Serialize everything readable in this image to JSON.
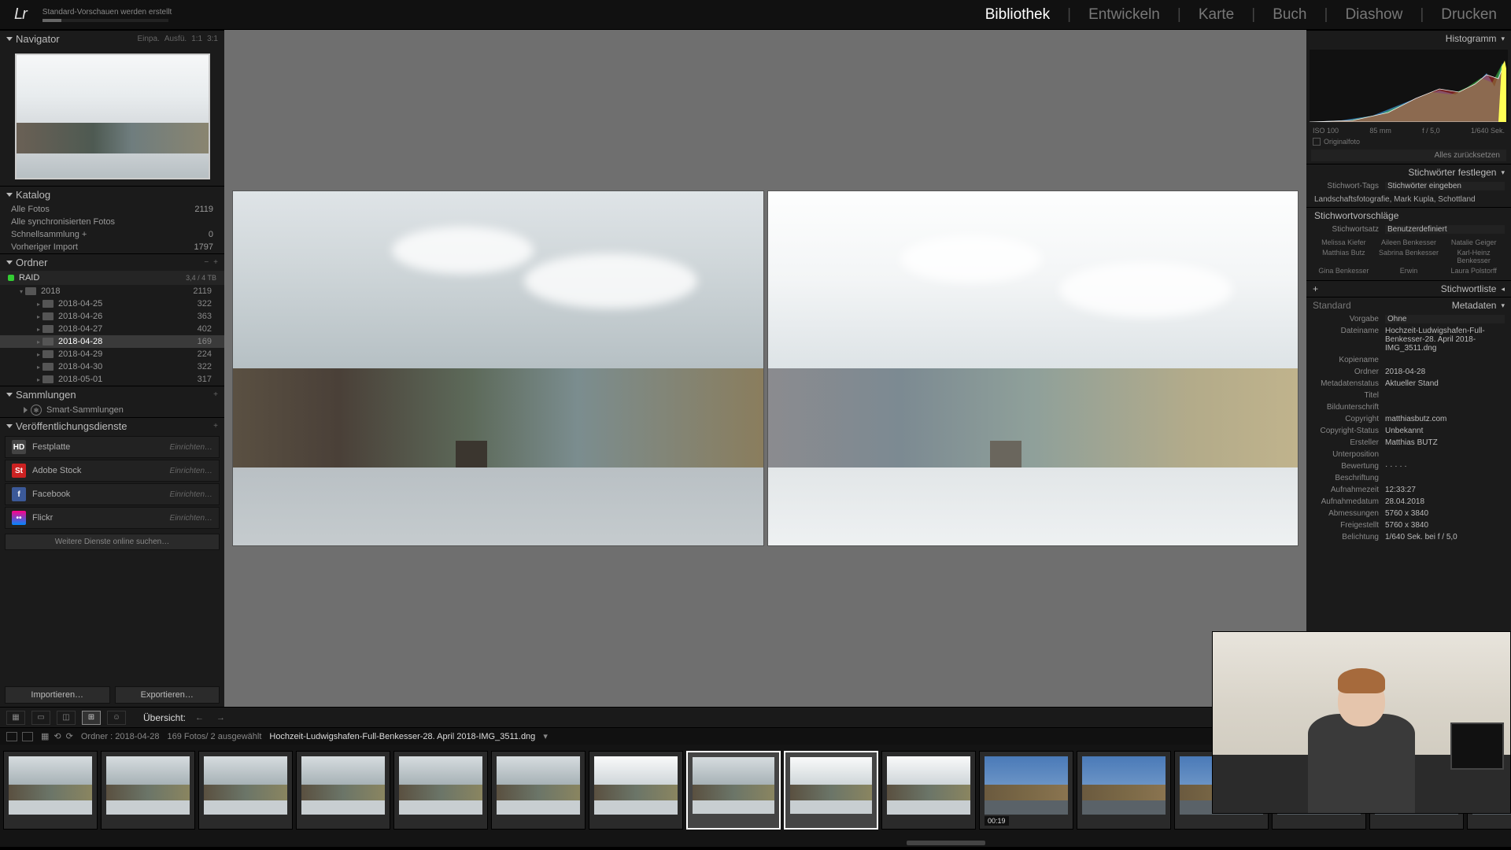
{
  "app": {
    "logo": "Lr",
    "task": "Standard-Vorschauen werden erstellt"
  },
  "modules": {
    "library": "Bibliothek",
    "develop": "Entwickeln",
    "map": "Karte",
    "book": "Buch",
    "slideshow": "Diashow",
    "print": "Drucken",
    "active": "library"
  },
  "left": {
    "navigator": {
      "title": "Navigator",
      "modes": [
        "Einpa.",
        "Ausfü.",
        "1:1",
        "3:1"
      ]
    },
    "catalog": {
      "title": "Katalog",
      "rows": [
        {
          "label": "Alle Fotos",
          "count": "2119"
        },
        {
          "label": "Alle synchronisierten Fotos",
          "count": ""
        },
        {
          "label": "Schnellsammlung  +",
          "count": "0"
        },
        {
          "label": "Vorheriger Import",
          "count": "1797"
        }
      ]
    },
    "folders": {
      "title": "Ordner",
      "volume": {
        "name": "RAID",
        "stat": "3,4 / 4 TB"
      },
      "year": {
        "label": "2018",
        "count": "2119"
      },
      "days": [
        {
          "label": "2018-04-25",
          "count": "322"
        },
        {
          "label": "2018-04-26",
          "count": "363"
        },
        {
          "label": "2018-04-27",
          "count": "402"
        },
        {
          "label": "2018-04-28",
          "count": "169",
          "sel": true
        },
        {
          "label": "2018-04-29",
          "count": "224"
        },
        {
          "label": "2018-04-30",
          "count": "322"
        },
        {
          "label": "2018-05-01",
          "count": "317"
        }
      ]
    },
    "collections": {
      "title": "Sammlungen",
      "smart": "Smart-Sammlungen"
    },
    "publish": {
      "title": "Veröffentlichungsdienste",
      "services": [
        {
          "name": "Festplatte",
          "class": "svc-hd",
          "icon": "HD"
        },
        {
          "name": "Adobe Stock",
          "class": "svc-st",
          "icon": "St"
        },
        {
          "name": "Facebook",
          "class": "svc-fb",
          "icon": "f"
        },
        {
          "name": "Flickr",
          "class": "svc-fl",
          "icon": "••"
        }
      ],
      "setup": "Einrichten…",
      "more": "Weitere Dienste online suchen…"
    },
    "import": "Importieren…",
    "export": "Exportieren…"
  },
  "toolbar": {
    "label": "Übersicht:"
  },
  "pathbar": {
    "folder": "Ordner : 2018-04-28",
    "count": "169 Fotos/  2 ausgewählt",
    "file": "Hochzeit-Ludwigshafen-Full-Benkesser-28. April 2018-IMG_3511.dng"
  },
  "right": {
    "histogram": {
      "title": "Histogramm",
      "info": [
        "ISO 100",
        "85 mm",
        "f / 5,0",
        "1/640 Sek."
      ],
      "original": "Originalfoto"
    },
    "reset": "Alles zurücksetzen",
    "keywords": {
      "title": "Stichwörter festlegen",
      "tags_label": "Stichwort-Tags",
      "tags_ph": "Stichwörter eingeben",
      "applied": "Landschaftsfotografie, Mark Kupla, Schottland"
    },
    "suggestions": {
      "title": "Stichwortvorschläge",
      "set_label": "Stichwortsatz",
      "set_value": "Benutzerdefiniert",
      "rows": [
        [
          "Melissa Kiefer",
          "Aileen Benkesser",
          "Natalie Geiger"
        ],
        [
          "Matthias Butz",
          "Sabrina Benkesser",
          "Karl-Heinz Benkesser"
        ],
        [
          "Gina Benkesser",
          "Erwin",
          "Laura Polstorff"
        ]
      ]
    },
    "keywordlist": {
      "title": "Stichwortliste"
    },
    "metadata": {
      "title": "Metadaten",
      "standard": "Standard",
      "preset_label": "Vorgabe",
      "preset_value": "Ohne",
      "items": [
        {
          "k": "Dateiname",
          "v": "Hochzeit-Ludwigshafen-Full-Benkesser-28. April 2018-IMG_3511.dng"
        },
        {
          "k": "Kopiename",
          "v": ""
        },
        {
          "k": "Ordner",
          "v": "2018-04-28"
        },
        {
          "k": "Metadatenstatus",
          "v": "Aktueller Stand"
        },
        {
          "k": "Titel",
          "v": ""
        },
        {
          "k": "Bildunterschrift",
          "v": ""
        },
        {
          "k": "Copyright",
          "v": "matthiasbutz.com"
        },
        {
          "k": "Copyright-Status",
          "v": "Unbekannt"
        },
        {
          "k": "Ersteller",
          "v": "Matthias BUTZ"
        },
        {
          "k": "Unterposition",
          "v": ""
        },
        {
          "k": "Bewertung",
          "v": "·  ·  ·  ·  ·"
        },
        {
          "k": "Beschriftung",
          "v": ""
        },
        {
          "k": "Aufnahmezeit",
          "v": "12:33:27"
        },
        {
          "k": "Aufnahmedatum",
          "v": "28.04.2018"
        },
        {
          "k": "Abmessungen",
          "v": "5760 x 3840"
        },
        {
          "k": "Freigestellt",
          "v": "5760 x 3840"
        },
        {
          "k": "Belichtung",
          "v": "1/640 Sek. bei f / 5,0"
        }
      ]
    }
  },
  "filmstrip": {
    "video_badge": "00:19",
    "thumbs": [
      {
        "sky": "dark",
        "land": "green",
        "water": "light"
      },
      {
        "sky": "dark",
        "land": "green",
        "water": "light"
      },
      {
        "sky": "dark",
        "land": "green",
        "water": "light"
      },
      {
        "sky": "dark",
        "land": "green",
        "water": "light"
      },
      {
        "sky": "dark",
        "land": "green",
        "water": "light"
      },
      {
        "sky": "dark",
        "land": "green",
        "water": "light"
      },
      {
        "sky": "bright",
        "land": "green",
        "water": "light"
      },
      {
        "sky": "dark",
        "land": "green",
        "water": "light",
        "sel": true
      },
      {
        "sky": "bright",
        "land": "green",
        "water": "light",
        "sel": true
      },
      {
        "sky": "bright",
        "land": "green",
        "water": "light"
      },
      {
        "sky": "blue",
        "land": "brown",
        "water": "dark",
        "video": true
      },
      {
        "sky": "blue",
        "land": "brown",
        "water": "dark"
      },
      {
        "sky": "blue",
        "land": "brown",
        "water": "dark"
      },
      {
        "sky": "dark",
        "land": "brown",
        "water": "dark"
      },
      {
        "sky": "dark",
        "land": "brown",
        "water": "dark"
      },
      {
        "sky": "dark",
        "land": "brown",
        "water": "dark"
      }
    ]
  }
}
